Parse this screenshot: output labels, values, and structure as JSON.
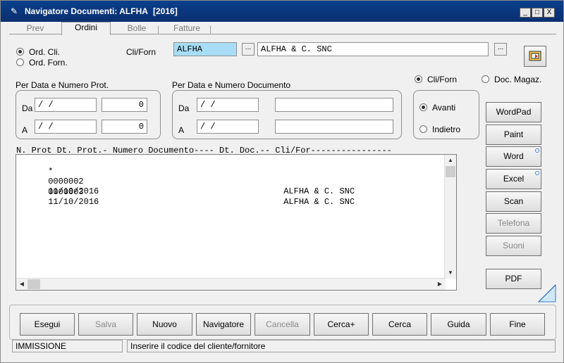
{
  "window": {
    "title": "Navigatore Documenti: ALFHA",
    "year": "[2016]",
    "controls": [
      "_",
      "□",
      "X"
    ]
  },
  "tabs": [
    {
      "label": "Prev",
      "active": false
    },
    {
      "label": "Ordini",
      "active": true
    },
    {
      "label": "Bolle",
      "active": false
    },
    {
      "label": "Fatture",
      "active": false
    }
  ],
  "order_type": {
    "options": [
      "Ord. Cli.",
      "Ord. Forn."
    ],
    "selected": "Ord. Cli."
  },
  "cliforn": {
    "label": "Cli/Forn",
    "code": "ALFHA",
    "name": "ALFHA & C. SNC",
    "lookup_label": "..."
  },
  "protocol_filter": {
    "title": "Per Data e Numero Prot.",
    "from_label": "Da",
    "to_label": "A",
    "from_date": " /  /",
    "to_date": " /  /",
    "from_num": "0",
    "to_num": "0"
  },
  "document_filter": {
    "title": "Per Data e Numero Documento",
    "from_label": "Da",
    "to_label": "A",
    "from_date": " /  /",
    "to_date": " /  /",
    "from_num": "",
    "to_num": ""
  },
  "source": {
    "options": [
      "Cli/Forn",
      "Doc. Magaz."
    ],
    "selected": "Cli/Forn"
  },
  "direction": {
    "options": [
      "Avanti",
      "Indietro"
    ],
    "selected": "Avanti"
  },
  "list": {
    "header": "N. Prot Dt. Prot.- Numero Documento---- Dt. Doc.-- Cli/For----------------",
    "rows": [
      {
        "marker": "*",
        "prot": "0000002",
        "date": "11/10/2016",
        "client": "ALFHA & C. SNC"
      },
      {
        "marker": " ",
        "prot": "0000003",
        "date": "11/10/2016",
        "client": "ALFHA & C. SNC"
      }
    ]
  },
  "side_buttons": [
    {
      "label": "WordPad",
      "enabled": true
    },
    {
      "label": "Paint",
      "enabled": true
    },
    {
      "label": "Word",
      "enabled": true
    },
    {
      "label": "Excel",
      "enabled": true
    },
    {
      "label": "Scan",
      "enabled": true
    },
    {
      "label": "Telefona",
      "enabled": false
    },
    {
      "label": "Suoni",
      "enabled": false
    },
    {
      "label": "PDF",
      "enabled": true
    }
  ],
  "bottom_buttons": [
    {
      "label": "Esegui",
      "enabled": true
    },
    {
      "label": "Salva",
      "enabled": false
    },
    {
      "label": "Nuovo",
      "enabled": true
    },
    {
      "label": "Navigatore",
      "enabled": true
    },
    {
      "label": "Cancella",
      "enabled": false
    },
    {
      "label": "Cerca+",
      "enabled": true
    },
    {
      "label": "Cerca",
      "enabled": true
    },
    {
      "label": "Guida",
      "enabled": true
    },
    {
      "label": "Fine",
      "enabled": true
    }
  ],
  "status": {
    "mode": "IMMISSIONE",
    "message": "Inserire il codice del cliente/fornitore"
  },
  "colors": {
    "titlebar": "#0b3a82",
    "field_highlight": "#a8ddf5"
  }
}
